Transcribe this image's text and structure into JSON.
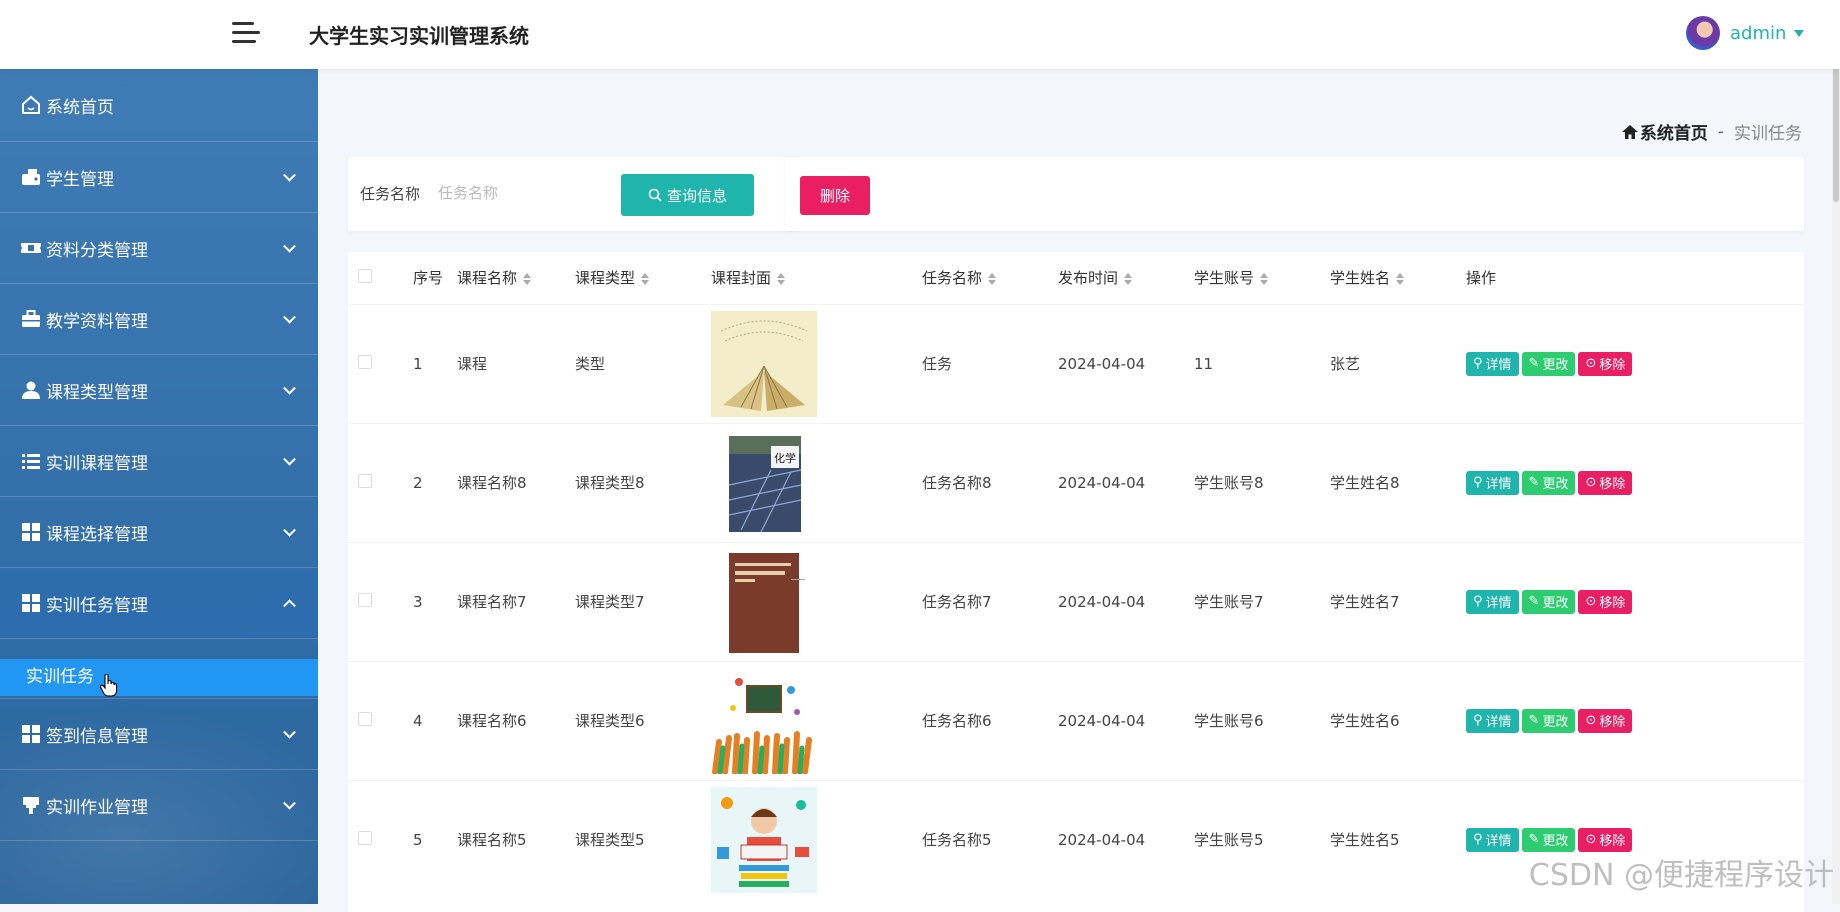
{
  "header": {
    "app_title": "大学生实习实训管理系统",
    "username": "admin"
  },
  "sidebar": {
    "items": [
      {
        "label": "系统首页",
        "icon": "home-icon"
      },
      {
        "label": "学生管理",
        "icon": "wallet-icon"
      },
      {
        "label": "资料分类管理",
        "icon": "ticket-icon"
      },
      {
        "label": "教学资料管理",
        "icon": "briefcase-icon"
      },
      {
        "label": "课程类型管理",
        "icon": "user-icon"
      },
      {
        "label": "实训课程管理",
        "icon": "list-icon"
      },
      {
        "label": "课程选择管理",
        "icon": "grid-icon"
      },
      {
        "label": "实训任务管理",
        "icon": "grid-icon"
      },
      {
        "label": "签到信息管理",
        "icon": "grid-icon"
      },
      {
        "label": "实训作业管理",
        "icon": "stamp-icon"
      }
    ],
    "sub_item": "实训任务"
  },
  "breadcrumb": {
    "home": "系统首页",
    "separator": "-",
    "current": "实训任务"
  },
  "search": {
    "label": "任务名称",
    "placeholder": "任务名称",
    "button": "查询信息"
  },
  "actions": {
    "delete": "删除"
  },
  "table": {
    "headers": [
      "序号",
      "课程名称",
      "课程类型",
      "课程封面",
      "任务名称",
      "发布时间",
      "学生账号",
      "学生姓名",
      "操作"
    ],
    "op_labels": {
      "detail": "详情",
      "edit": "更改",
      "remove": "移除"
    },
    "rows": [
      {
        "no": "1",
        "course": "课程",
        "type": "类型",
        "cover": "open-book-cover",
        "task": "任务",
        "time": "2024-04-04",
        "account": "11",
        "name": "张艺"
      },
      {
        "no": "2",
        "course": "课程名称8",
        "type": "课程类型8",
        "cover": "chemistry-book-cover",
        "task": "任务名称8",
        "time": "2024-04-04",
        "account": "学生账号8",
        "name": "学生姓名8"
      },
      {
        "no": "3",
        "course": "课程名称7",
        "type": "课程类型7",
        "cover": "brown-book-cover",
        "task": "任务名称7",
        "time": "2024-04-04",
        "account": "学生账号7",
        "name": "学生姓名7"
      },
      {
        "no": "4",
        "course": "课程名称6",
        "type": "课程类型6",
        "cover": "hands-chalkboard-cover",
        "task": "任务名称6",
        "time": "2024-04-04",
        "account": "学生账号6",
        "name": "学生姓名6"
      },
      {
        "no": "5",
        "course": "课程名称5",
        "type": "课程类型5",
        "cover": "student-reading-cover",
        "task": "任务名称5",
        "time": "2024-04-04",
        "account": "学生账号5",
        "name": "学生姓名5"
      }
    ]
  },
  "watermark": "CSDN @便捷程序设计",
  "colors": {
    "accent": "#1fb5ac",
    "edit": "#2ecc71",
    "danger": "#e91e63",
    "sidebar": "#3673ad",
    "active_sub": "#2196f3"
  }
}
